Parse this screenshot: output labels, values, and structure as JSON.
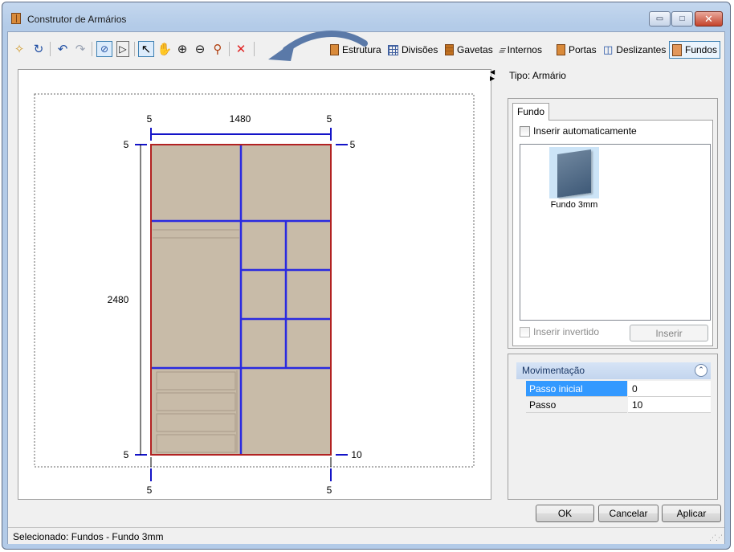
{
  "window": {
    "title": "Construtor de Armários",
    "controls": {
      "minimize": "▭",
      "maximize": "□",
      "close": "✕"
    }
  },
  "toolbar": {
    "icons": [
      "new-icon",
      "refresh-icon",
      "undo-icon",
      "redo-icon",
      "fit-view-icon",
      "page-view-icon",
      "select-pointer-icon",
      "pan-hand-icon",
      "zoom-in-icon",
      "zoom-out-icon",
      "zoom-window-icon",
      "delete-icon"
    ],
    "tabs": [
      {
        "label": "Estrutura"
      },
      {
        "label": "Divisões"
      },
      {
        "label": "Gavetas"
      },
      {
        "label": "Internos"
      },
      {
        "label": "Portas"
      },
      {
        "label": "Deslizantes"
      },
      {
        "label": "Fundos"
      }
    ],
    "active_tab": "Fundos"
  },
  "drawing": {
    "width_dim": "1480",
    "height_dim": "2480",
    "gap_left_top": "5",
    "gap_right_top": "5",
    "gap_top_left": "5",
    "gap_top_right": "5",
    "gap_bottom_left": "5",
    "gap_bottom_right": "10",
    "gap_below_left": "5",
    "gap_below_right": "5",
    "colors": {
      "panel": "#c8bba8",
      "outline": "#b22222",
      "division": "#2a2ae0",
      "dimension": "#1414c8"
    }
  },
  "right_panel": {
    "tipo": "Tipo: Armário",
    "fundo_tab": "Fundo",
    "auto_insert_label": "Inserir automaticamente",
    "items": [
      {
        "label": "Fundo 3mm"
      }
    ],
    "invert_label": "Inserir invertido",
    "insert_button": "Inserir",
    "movement": {
      "title": "Movimentação",
      "rows": [
        {
          "key": "Passo inicial",
          "value": "0"
        },
        {
          "key": "Passo",
          "value": "10"
        }
      ]
    }
  },
  "buttons": {
    "ok": "OK",
    "cancel": "Cancelar",
    "apply": "Aplicar"
  },
  "status": {
    "text": "Selecionado: Fundos - Fundo 3mm"
  }
}
